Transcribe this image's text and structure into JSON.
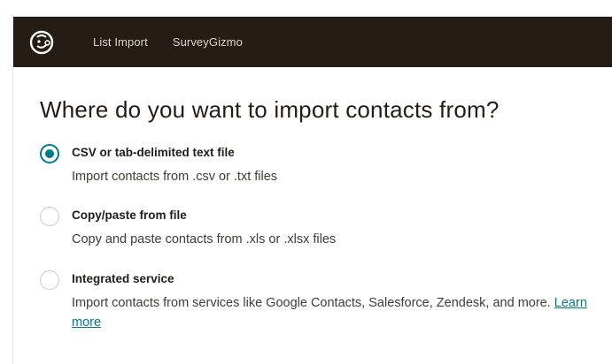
{
  "header": {
    "logo_icon": "mailchimp-freddie-logo",
    "nav": [
      {
        "label": "List Import"
      },
      {
        "label": "SurveyGizmo"
      }
    ],
    "background_color": "#241c15"
  },
  "main": {
    "title": "Where do you want to import contacts from?",
    "options": [
      {
        "title": "CSV or tab-delimited text file",
        "description": "Import contacts from .csv or .txt files",
        "selected": true
      },
      {
        "title": "Copy/paste from file",
        "description": "Copy and paste contacts from .xls or .xlsx files",
        "selected": false
      },
      {
        "title": "Integrated service",
        "description": "Import contacts from services like Google Contacts, Salesforce, Zendesk, and more.",
        "link_label": "Learn more",
        "selected": false
      }
    ]
  },
  "colors": {
    "accent": "#007c89",
    "text": "#241c15"
  }
}
